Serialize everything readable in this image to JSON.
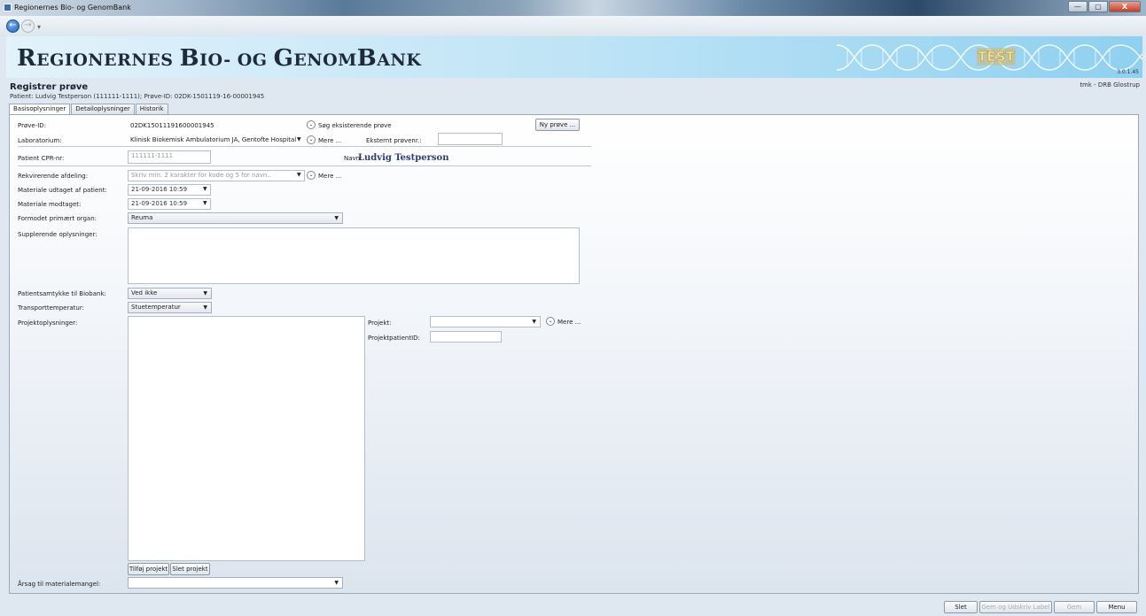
{
  "window": {
    "title": "Regionernes Bio- og GenomBank",
    "minimize": "—",
    "maximize": "▢",
    "close": "X"
  },
  "nav": {
    "back_icon": "arrow-left-icon",
    "forward_icon": "arrow-right-icon",
    "dropdown": "▾"
  },
  "banner": {
    "brand_part1": "R",
    "brand_part2": "EGIONERNES ",
    "brand_part3": "B",
    "brand_part4": "IO- OG ",
    "brand_part5": "G",
    "brand_part6": "ENOM",
    "brand_part7": "B",
    "brand_part8": "ANK",
    "test_label": "TEST",
    "version": "3.0.1.45"
  },
  "header": {
    "page_title": "Registrer prøve",
    "user": "tmk - DRB Glostrup",
    "patient_line": "Patient: Ludvig Testperson (111111-1111); Prøve-ID: 02DK-1501119-16-00001945"
  },
  "tabs": [
    {
      "label": "Basisoplysninger",
      "active": true
    },
    {
      "label": "Detailoplysninger",
      "active": false
    },
    {
      "label": "Historik",
      "active": false
    }
  ],
  "form": {
    "prove_id_label": "Prøve-ID:",
    "prove_id_value": "02DK15011191600001945",
    "search_existing": "Søg eksisterende prøve",
    "new_sample_button": "Ny prøve ...",
    "laboratorium_label": "Laboratorium:",
    "laboratorium_value": "Klinisk Biokemisk Ambulatorium JA, Gentofte Hospital",
    "mere1": "Mere ...",
    "external_label": "Eksternt prøvenr.:",
    "external_value": "",
    "cpr_label": "Patient CPR-nr:",
    "cpr_value": "111111-1111",
    "name_label": "Navn:",
    "name_value": "Ludvig Testperson",
    "rekv_label": "Rekvirerende afdeling:",
    "rekv_placeholder": "Skriv min. 2 karakter for kode og 5 for navn..",
    "mere2": "Mere ...",
    "udtaget_label": "Materiale udtaget af patient:",
    "udtaget_value": "21-09-2016 10:59",
    "modtaget_label": "Materiale modtaget:",
    "modtaget_value": "21-09-2016 10:59",
    "organ_label": "Formodet primært organ:",
    "organ_value": "Reuma",
    "supp_label": "Supplerende oplysninger:",
    "samtykke_label": "Patientsamtykke til Biobank:",
    "samtykke_value": "Ved ikke",
    "transport_label": "Transporttemperatur:",
    "transport_value": "Stuetemperatur",
    "projekt_info_label": "Projektoplysninger:",
    "projekt_label": "Projekt:",
    "projekt_value": "",
    "mere3": "Mere ...",
    "projektpatient_label": "ProjektpatientID:",
    "projektpatient_value": "",
    "add_project": "Tilføj projekt",
    "delete_project": "Slet projekt",
    "aarsag_label": "Årsag til materialemangel:",
    "aarsag_value": ""
  },
  "footer": {
    "delete": "Slet",
    "save_print": "Gem og Udskriv Label",
    "save": "Gem",
    "menu": "Menu"
  }
}
